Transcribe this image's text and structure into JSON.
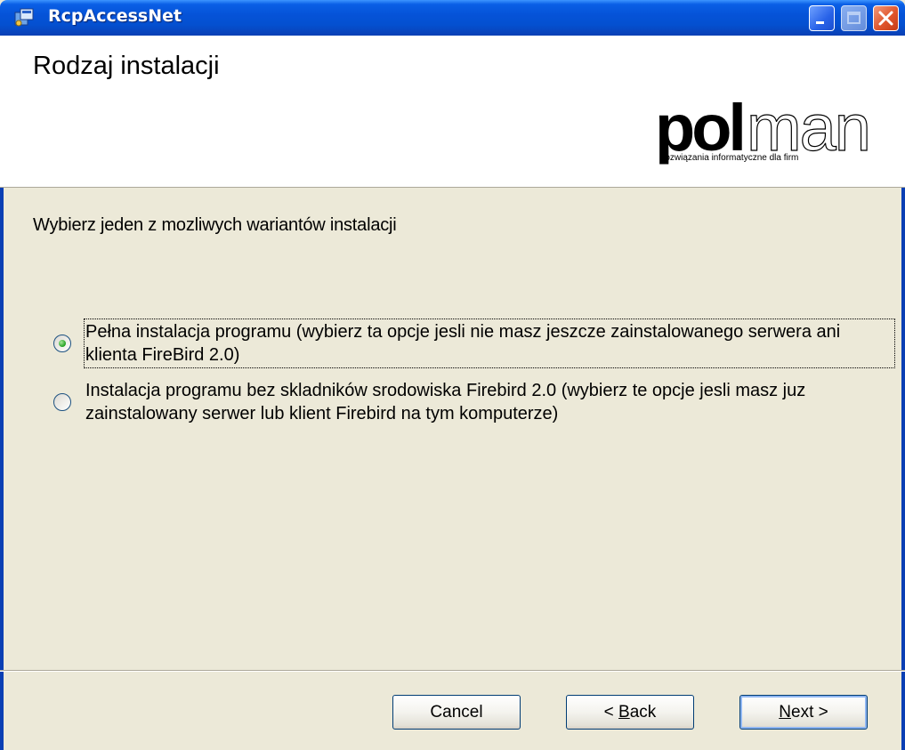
{
  "window": {
    "title": "RcpAccessNet",
    "icon": "installer-icon"
  },
  "header": {
    "title": "Rodzaj instalacji",
    "logo": {
      "brand": "polman",
      "tagline": "rozwiązania informatyczne dla firm"
    }
  },
  "content": {
    "instruction": "Wybierz jeden z mozliwych wariantów instalacji",
    "options": [
      {
        "label": "Pełna instalacja programu (wybierz ta opcje jesli nie masz jeszcze zainstalowanego serwera ani klienta FireBird 2.0)",
        "selected": true
      },
      {
        "label": "Instalacja programu bez skladników srodowiska Firebird 2.0 (wybierz te opcje jesli masz juz zainstalowany serwer lub klient Firebird na tym komputerze)",
        "selected": false
      }
    ]
  },
  "buttons": {
    "cancel": "Cancel",
    "back_prefix": "< ",
    "back_mnemonic": "B",
    "back_rest": "ack",
    "next_mnemonic": "N",
    "next_rest": "ext >"
  },
  "colors": {
    "titlebar": "#0553d8",
    "dialog_bg": "#ece9d8",
    "header_bg": "#ffffff",
    "radio_selected": "#21a121"
  }
}
